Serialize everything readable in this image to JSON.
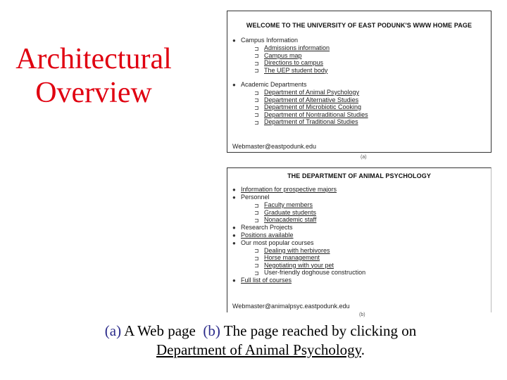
{
  "slide": {
    "title_line1": "Architectural",
    "title_line2": "Overview",
    "title_color": "#e00010"
  },
  "page_a": {
    "heading": "WELCOME TO THE UNIVERSITY OF EAST PODUNK'S WWW HOME PAGE",
    "sections": [
      {
        "label": "Campus Information",
        "items": [
          "Admissions information",
          "Campus map",
          "Directions to campus",
          "The UEP student body"
        ]
      },
      {
        "label": "Academic Departments",
        "items": [
          "Department of Animal Psychology",
          "Department of Alternative Studies",
          "Department of Microbiotic Cooking",
          "Department of Nontraditional Studies",
          "Department of Traditional Studies"
        ]
      }
    ],
    "footer": "Webmaster@eastpodunk.edu",
    "label": "(a)"
  },
  "page_b": {
    "heading": "THE DEPARTMENT OF ANIMAL PSYCHOLOGY",
    "items": [
      {
        "label": "Information for prospective majors",
        "link": true
      },
      {
        "label": "Personnel",
        "link": false,
        "sub": [
          "Faculty members",
          "Graduate students",
          "Nonacademic staff"
        ]
      },
      {
        "label": "Research Projects",
        "link": false
      },
      {
        "label": "Positions available",
        "link": true
      },
      {
        "label": "Our most popular courses",
        "link": false,
        "sub": [
          "Dealing with herbivores",
          "Horse management",
          "Negotiating with your pet",
          "User-friendly doghouse construction"
        ]
      },
      {
        "label": "Full list of courses",
        "link": true
      }
    ],
    "footer": "Webmaster@animalpsyc.eastpodunk.edu",
    "label": "(b)"
  },
  "caption": {
    "tag_a": "(a)",
    "text_a": " A Web page  ",
    "tag_b": "(b)",
    "text_b": " The page reached by clicking on",
    "link_text": "Department of Animal Psychology",
    "end": "."
  }
}
